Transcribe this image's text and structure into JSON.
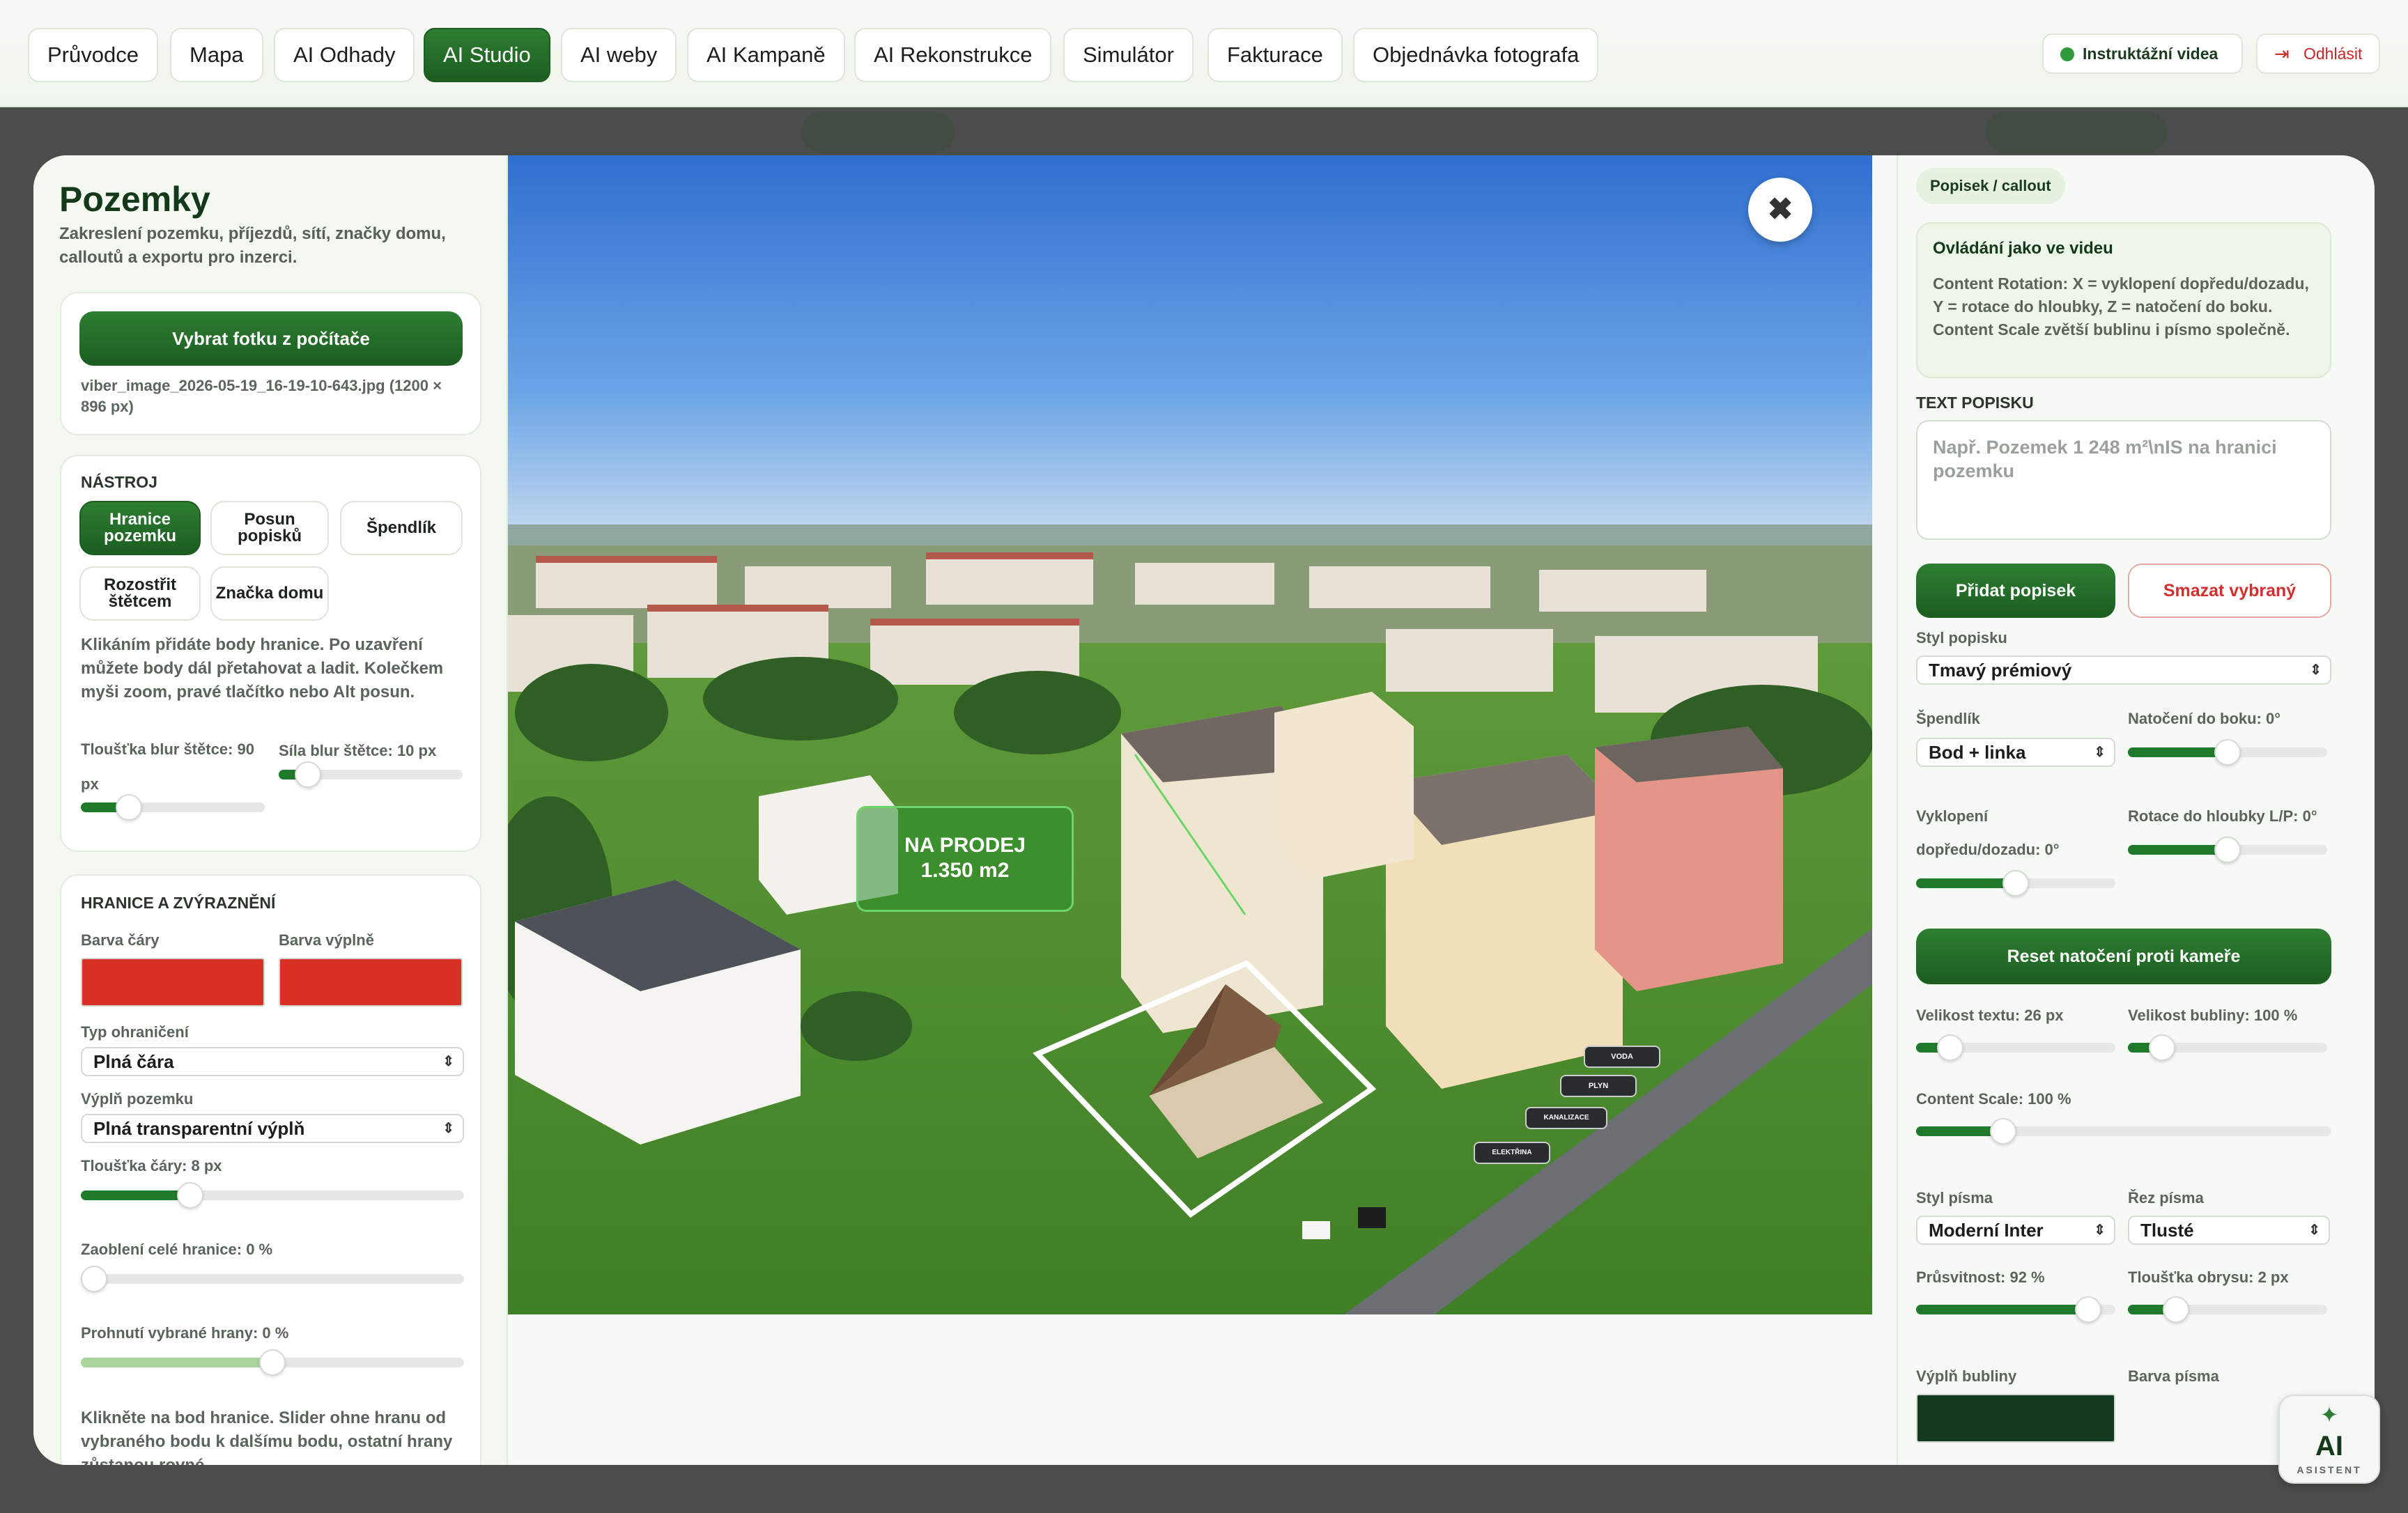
{
  "nav": {
    "tabs": [
      "Průvodce",
      "Mapa",
      "AI Odhady",
      "AI Studio",
      "AI weby",
      "AI Kampaně",
      "AI Rekonstrukce",
      "Simulátor",
      "Fakturace",
      "Objednávka fotografa"
    ],
    "active_tab": "AI Studio",
    "videos_label": "Instruktážní videa",
    "logout_label": "Odhlásit"
  },
  "left": {
    "title": "Pozemky",
    "description": "Zakreslení pozemku, příjezdů, sítí, značky domu, calloutů a exportu pro inzerci.",
    "upload_button": "Vybrat fotku z počítače",
    "file_info": "viber_image_2026-05-19_16-19-10-643.jpg (1200 × 896 px)",
    "tool_section": "NÁSTROJ",
    "tools": [
      "Hranice pozemku",
      "Posun popisků",
      "Špendlík",
      "Rozostřit štětcem",
      "Značka domu"
    ],
    "active_tool": "Hranice pozemku",
    "tool_help": "Klikáním přidáte body hranice. Po uzavření můžete body dál přetahovat a ladit. Kolečkem myši zoom, pravé tlačítko nebo Alt posun.",
    "blur_thickness_label": "Tloušťka blur štětce: 90 px",
    "blur_thickness_value": 0.22,
    "blur_strength_label": "Síla blur štětce: 10 px",
    "blur_strength_value": 0.1,
    "boundary_section": "HRANICE A ZVÝRAZNĚNÍ",
    "line_color_label": "Barva čáry",
    "fill_color_label": "Barva výplně",
    "line_color": "#d93025",
    "fill_color": "#d93025",
    "boundary_type_label": "Typ ohraničení",
    "boundary_type_value": "Plná čára",
    "plot_fill_label": "Výplň pozemku",
    "plot_fill_value": "Plná transparentní výplň",
    "line_thickness_label": "Tloušťka čáry: 8 px",
    "line_thickness_value": 0.27,
    "rounding_label": "Zaoblení celé hranice: 0 %",
    "rounding_value": 0,
    "bend_label": "Prohnutí vybrané hrany: 0 %",
    "bend_value": 0.5,
    "bottom_help": "Klikněte na bod hranice. Slider ohne hranu od vybraného bodu k dalšímu bodu, ostatní hrany zůstanou rovné."
  },
  "image": {
    "callout_text_line1": "NA PRODEJ",
    "callout_text_line2": "1.350 m2",
    "pins": [
      "VODA",
      "PLYN",
      "KANALIZACE",
      "ELEKTŘINA"
    ],
    "close_icon": "close-icon"
  },
  "right": {
    "tab": "Popisek / callout",
    "controls_title": "Ovládání jako ve videu",
    "controls_body": "Content Rotation: X = vyklopení dopředu/dozadu, Y = rotace do hloubky, Z = natočení do boku. Content Scale zvětší bublinu i písmo společně.",
    "text_label": "TEXT POPISKU",
    "text_placeholder": "Např. Pozemek 1 248 m²\\nIS na hranici pozemku",
    "add_button": "Přidat popisek",
    "delete_button": "Smazat vybraný",
    "style_label": "Styl popisku",
    "style_value": "Tmavý prémiový",
    "pin_label": "Špendlík",
    "pin_value": "Bod + linka",
    "side_rotation_label": "Natočení do boku: 0°",
    "side_rotation_value": 0.5,
    "tilt_label_1": "Vyklopení",
    "tilt_label_2": "dopředu/dozadu: 0°",
    "tilt_value": 0.5,
    "depth_rotation_label": "Rotace do hloubky L/P: 0°",
    "depth_rotation_value": 0.5,
    "reset_button": "Reset natočení proti kameře",
    "text_size_label": "Velikost textu: 26 px",
    "text_size_value": 0.12,
    "bubble_size_label": "Velikost bubliny: 100 %",
    "bubble_size_value": 0.12,
    "content_scale_label": "Content Scale: 100 %",
    "content_scale_value": 0.19,
    "font_style_label": "Styl písma",
    "font_style_value": "Moderní Inter",
    "font_cut_label": "Řez písma",
    "font_cut_value": "Tlusté",
    "opacity_label": "Průsvitnost: 92 %",
    "opacity_value": 0.92,
    "outline_label": "Tloušťka obrysu: 2 px",
    "outline_value": 0.2,
    "bubble_fill_label": "Výplň bubliny",
    "bubble_fill_color": "#123820",
    "font_color_label": "Barva písma"
  },
  "assistant": {
    "label": "AI",
    "sub": "ASISTENT"
  }
}
